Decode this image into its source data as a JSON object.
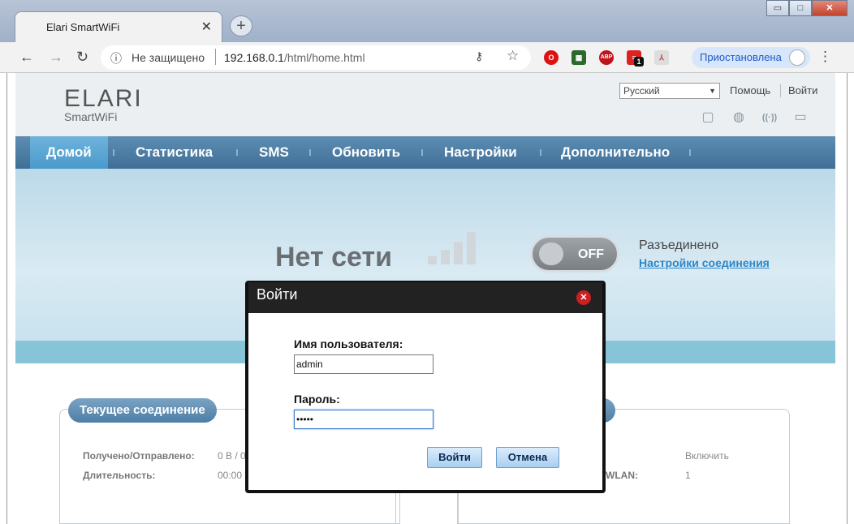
{
  "browser": {
    "tab_title": "Elari SmartWiFi",
    "tab_close": "✕",
    "new_tab": "+",
    "security_label": "Не защищено",
    "url_host": "192.168.0.1",
    "url_path": "/html/home.html",
    "profile_status": "Приостановлена",
    "window_controls": {
      "minimize": "▭",
      "maximize": "□",
      "close": "✕"
    },
    "extensions": [
      "opera-icon",
      "media-icon",
      "adblock-icon",
      "todo-icon",
      "pdf-icon"
    ],
    "extension_badge": "1",
    "extension_abp_label": "ABP"
  },
  "header": {
    "logo_main": "ELARI",
    "logo_sub": "SmartWiFi",
    "language": "Русский",
    "help_label": "Помощь",
    "login_label": "Войти"
  },
  "nav": {
    "items": [
      "Домой",
      "Статистика",
      "SMS",
      "Обновить",
      "Настройки",
      "Дополнительно"
    ],
    "active": "Домой"
  },
  "banner": {
    "network_status": "Нет сети",
    "signal_level": 0,
    "switch_label": "OFF",
    "connection_state": "Разъединено",
    "connection_settings_link": "Настройки соединения"
  },
  "panels": {
    "current_connection": {
      "title": "Текущее соединение",
      "rows": [
        {
          "label": "Получено/Отправлено:",
          "value": "0 B / 0"
        },
        {
          "label": "Длительность:",
          "value": "00:00"
        }
      ]
    },
    "wlan": {
      "rows": [
        {
          "label": "",
          "value": "Включить"
        },
        {
          "label": "WLAN:",
          "value": "1"
        }
      ]
    }
  },
  "login_dialog": {
    "title": "Войти",
    "username_label": "Имя пользователя:",
    "username_value": "admin",
    "password_label": "Пароль:",
    "password_value": "•••••",
    "submit_label": "Войти",
    "cancel_label": "Отмена"
  },
  "colors": {
    "nav_bg": "#4a7aa3",
    "nav_active": "#5fa6d4",
    "link": "#2c87c9",
    "dialog_header": "#222222",
    "close_red": "#cc1f1f"
  }
}
